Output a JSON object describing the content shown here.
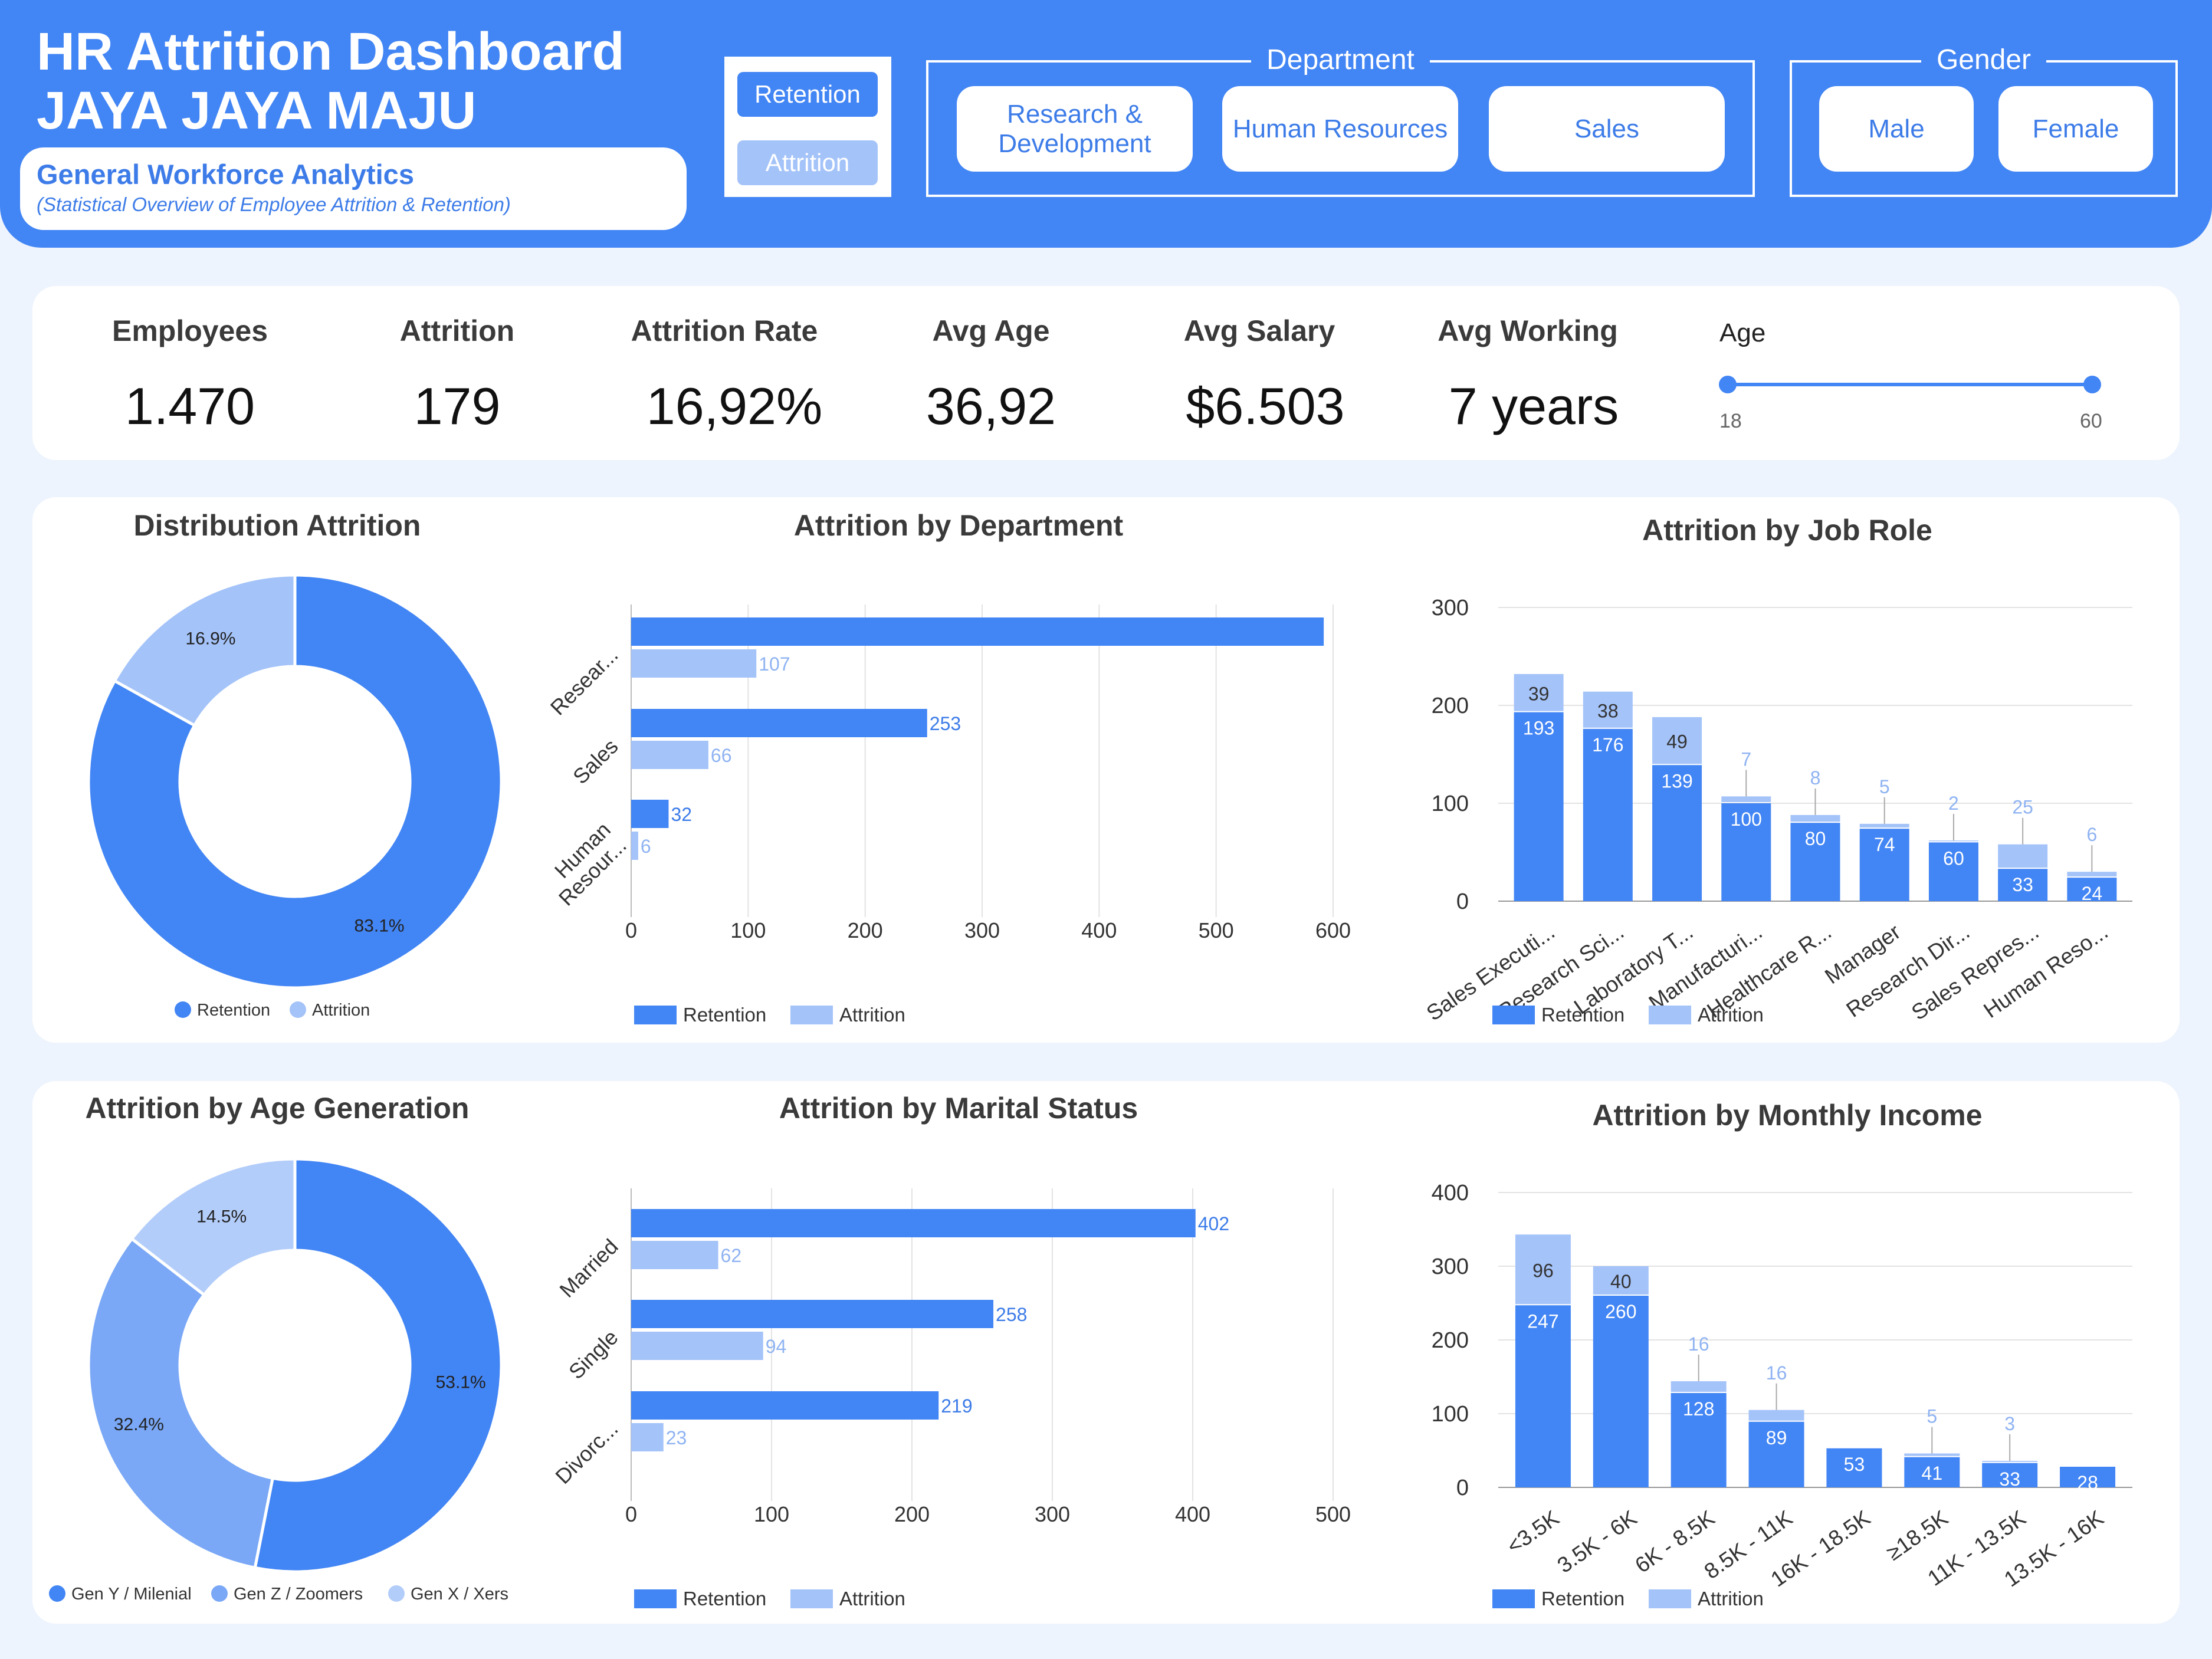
{
  "header": {
    "title_line1": "HR Attrition Dashboard",
    "title_line2": "JAYA JAYA MAJU",
    "subtitle": "General Workforce Analytics",
    "subtitle_note": "(Statistical Overview of Employee Attrition & Retention)"
  },
  "toggle": {
    "retention": "Retention",
    "attrition": "Attrition"
  },
  "filters": {
    "department_label": "Department",
    "department_options": [
      "Research & Development",
      "Human Resources",
      "Sales"
    ],
    "gender_label": "Gender",
    "gender_options": [
      "Male",
      "Female"
    ]
  },
  "kpis": [
    {
      "label": "Employees",
      "value": "1.470"
    },
    {
      "label": "Attrition",
      "value": "179"
    },
    {
      "label": "Attrition Rate",
      "value": "16,92%"
    },
    {
      "label": "Avg Age",
      "value": "36,92"
    },
    {
      "label": "Avg Salary",
      "value": "$6.503"
    },
    {
      "label": "Avg Working",
      "value": "7 years"
    }
  ],
  "age_slider": {
    "label": "Age",
    "min": "18",
    "max": "60",
    "range": [
      18,
      60
    ]
  },
  "colors": {
    "retention": "#4285f4",
    "attrition": "#a4c3f9",
    "gen_z": "#7aa8f6",
    "gen_x": "#b3cdfa"
  },
  "chart_data": [
    {
      "id": "distribution",
      "type": "pie",
      "title": "Distribution Attrition",
      "labels": [
        "Retention",
        "Attrition"
      ],
      "values": [
        83.1,
        16.9
      ],
      "value_labels": [
        "83.1%",
        "16.9%"
      ],
      "legend": "bottom"
    },
    {
      "id": "department",
      "type": "bar",
      "orientation": "horizontal",
      "title": "Attrition by Department",
      "categories": [
        "Resear...",
        "Sales",
        "Human Resour..."
      ],
      "series": [
        {
          "name": "Retention",
          "values": [
            592,
            253,
            32
          ],
          "labels": [
            "",
            "253",
            "32"
          ]
        },
        {
          "name": "Attrition",
          "values": [
            107,
            66,
            6
          ],
          "labels": [
            "107",
            "66",
            "6"
          ]
        }
      ],
      "xlim": [
        0,
        600
      ],
      "ticks": [
        "0",
        "100",
        "200",
        "300",
        "400",
        "500",
        "600"
      ],
      "legend": "bottom"
    },
    {
      "id": "jobrole",
      "type": "bar",
      "stacked": true,
      "title": "Attrition by Job Role",
      "categories": [
        "Sales Executi...",
        "Research Sci...",
        "Laboratory T...",
        "Manufacturi...",
        "Healthcare R...",
        "Manager",
        "Research Dir...",
        "Sales Repres...",
        "Human Reso..."
      ],
      "series": [
        {
          "name": "Retention",
          "values": [
            193,
            176,
            139,
            100,
            80,
            74,
            60,
            33,
            24
          ]
        },
        {
          "name": "Attrition",
          "values": [
            39,
            38,
            49,
            7,
            8,
            5,
            2,
            25,
            6
          ]
        }
      ],
      "ylim": [
        0,
        300
      ],
      "ticks": [
        "0",
        "100",
        "200",
        "300"
      ],
      "legend": "bottom"
    },
    {
      "id": "generation",
      "type": "pie",
      "title": "Attrition by Age Generation",
      "labels": [
        "Gen Y / Milenial",
        "Gen Z / Zoomers",
        "Gen X / Xers"
      ],
      "values": [
        53.1,
        32.4,
        14.5
      ],
      "value_labels": [
        "53.1%",
        "32.4%",
        "14.5%"
      ],
      "legend": "bottom"
    },
    {
      "id": "marital",
      "type": "bar",
      "orientation": "horizontal",
      "title": "Attrition by Marital Status",
      "categories": [
        "Married",
        "Single",
        "Divorc..."
      ],
      "series": [
        {
          "name": "Retention",
          "values": [
            402,
            258,
            219
          ],
          "labels": [
            "402",
            "258",
            "219"
          ]
        },
        {
          "name": "Attrition",
          "values": [
            62,
            94,
            23
          ],
          "labels": [
            "62",
            "94",
            "23"
          ]
        }
      ],
      "xlim": [
        0,
        500
      ],
      "ticks": [
        "0",
        "100",
        "200",
        "300",
        "400",
        "500"
      ],
      "legend": "bottom"
    },
    {
      "id": "income",
      "type": "bar",
      "stacked": true,
      "title": "Attrition by Monthly Income",
      "categories": [
        "<3.5K",
        "3.5K - 6K",
        "6K - 8.5K",
        "8.5K - 11K",
        "16K - 18.5K",
        "≥18.5K",
        "11K - 13.5K",
        "13.5K - 16K"
      ],
      "series": [
        {
          "name": "Retention",
          "values": [
            247,
            260,
            128,
            89,
            53,
            41,
            33,
            28
          ]
        },
        {
          "name": "Attrition",
          "values": [
            96,
            40,
            16,
            16,
            0,
            5,
            3,
            0
          ]
        }
      ],
      "ylim": [
        0,
        400
      ],
      "ticks": [
        "0",
        "100",
        "200",
        "300",
        "400"
      ],
      "legend": "bottom"
    }
  ]
}
